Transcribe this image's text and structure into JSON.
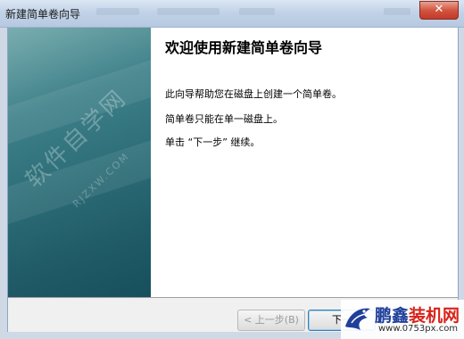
{
  "window": {
    "title": "新建简单卷向导",
    "close_glyph": "✕"
  },
  "wizard": {
    "heading": "欢迎使用新建简单卷向导",
    "lines": [
      "此向导帮助您在磁盘上创建一个简单卷。",
      "简单卷只能在单一磁盘上。",
      "单击 “下一步” 继续。"
    ]
  },
  "watermark": {
    "text": "软件自学网",
    "sub": "RJZXW.COM"
  },
  "buttons": {
    "back": "< 上一步(B)",
    "next": "下一"
  },
  "logo": {
    "name_blue": "鹏鑫",
    "name_red": "装机网",
    "url": "www.0753px.com"
  },
  "colors": {
    "panel": "#2c6d77",
    "logo_blue": "#1f3f9a",
    "logo_red": "#d8231b"
  }
}
